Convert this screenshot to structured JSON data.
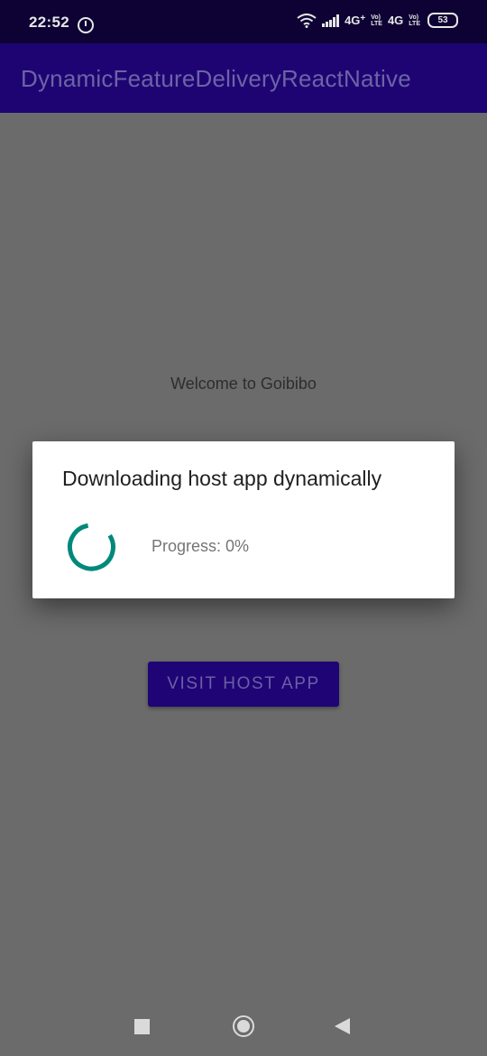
{
  "status_bar": {
    "time": "22:52",
    "alarm_icon": "alarm-icon",
    "wifi_icon": "wifi-icon",
    "signal_icon": "signal-icon",
    "network_1": "4G",
    "network_1_suffix": "+",
    "volte_1_top": "Vo)",
    "volte_1_bottom": "LTE",
    "network_2": "4G",
    "volte_2_top": "Vo)",
    "volte_2_bottom": "LTE",
    "battery": "53"
  },
  "app_bar": {
    "title": "DynamicFeatureDeliveryReactNative",
    "background": "#1e0473"
  },
  "main": {
    "welcome_text": "Welcome to Goibibo",
    "visit_button_label": "VISIT HOST APP",
    "background": "#6b6b6b"
  },
  "dialog": {
    "title": "Downloading host app dynamically",
    "progress_label": "Progress: 0%",
    "progress_percent": 0,
    "spinner_color": "#00897b"
  },
  "nav_bar": {
    "recents_icon": "recents-icon",
    "home_icon": "home-icon",
    "back_icon": "back-icon"
  }
}
